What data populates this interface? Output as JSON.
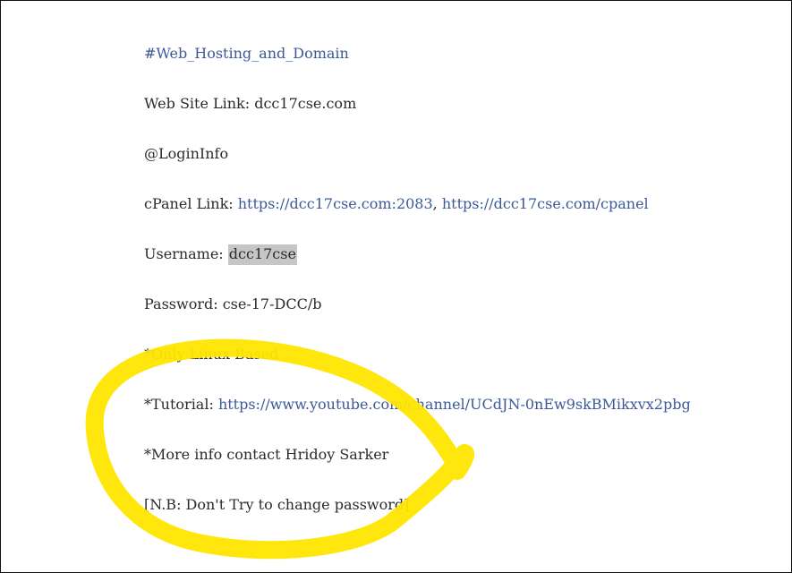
{
  "doc": {
    "heading": "#Web_Hosting_and_Domain",
    "website_label": "Web Site Link: ",
    "website_value": "dcc17cse.com",
    "login_info": "@LoginInfo",
    "cpanel_label": "cPanel Link: ",
    "cpanel_link1": "https://dcc17cse.com:2083",
    "cpanel_sep": ", ",
    "cpanel_link2": "https://dcc17cse.com/cpanel",
    "username_label": "Username: ",
    "username_value": "dcc17cse",
    "password_label": "Password: ",
    "password_value": "cse-17-DCC/b",
    "note_linux": "*Only Linux Based",
    "tutorial_label": "*Tutorial: ",
    "tutorial_link": "https://www.youtube.com/channel/UCdJN-0nEw9skBMikxvx2pbg",
    "note_contact": "*More info contact Hridoy Sarker",
    "note_nb": "[N.B: Don't Try to change password]"
  },
  "colors": {
    "link": "#3b5998",
    "text": "#2b2b2b",
    "highlight": "#c6c6c6",
    "annotation": "#ffe600"
  }
}
